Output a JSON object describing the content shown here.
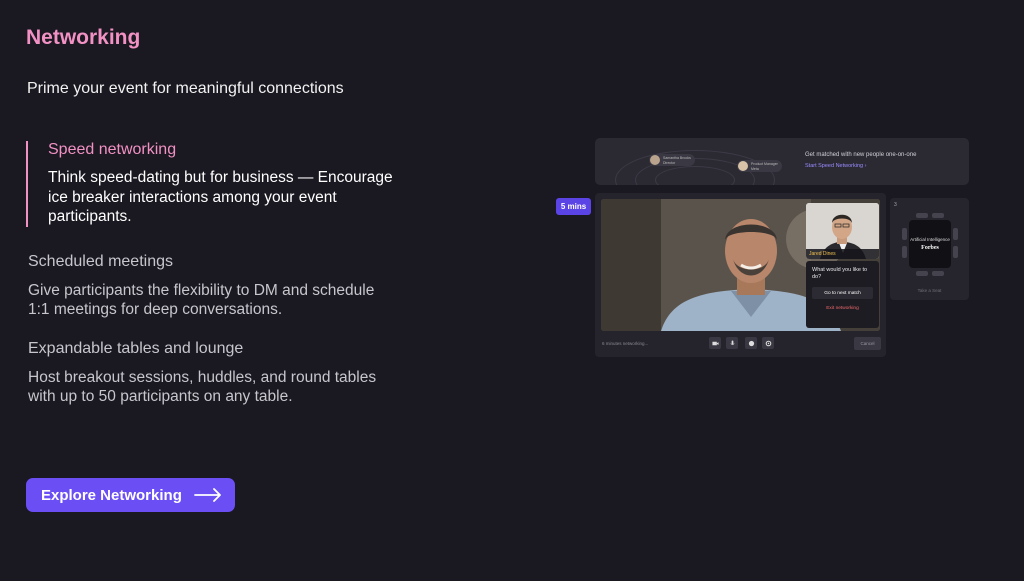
{
  "section": {
    "title": "Networking",
    "subtitle": "Prime your event for meaningful connections"
  },
  "features": [
    {
      "title": "Speed networking",
      "description": "Think speed-dating but for business — Encourage ice breaker interactions among your event participants."
    },
    {
      "title": "Scheduled meetings",
      "description": "Give participants the flexibility to DM and schedule 1:1 meetings for deep conversations."
    },
    {
      "title": "Expandable tables and lounge",
      "description": "Host breakout sessions, huddles, and round tables with up to 50 participants on any table."
    }
  ],
  "cta": {
    "label": "Explore Networking",
    "icon": "arrow-right-icon"
  },
  "mockup": {
    "top_card": {
      "chips": [
        {
          "name": "Samantha Brooks",
          "role": "Director"
        },
        {
          "name": "Product Manager",
          "role": "Meta"
        }
      ],
      "title": "Get matched with new people one-on-one",
      "link": "Start Speed Networking"
    },
    "timer_badge": "5 mins",
    "self_name": "Jared Dines",
    "prompt": {
      "question": "What would you like to do?",
      "primary": "Go to next match",
      "secondary": "Exit networking"
    },
    "controls": {
      "status": "6 minutes networking...",
      "cancel": "Cancel",
      "icons": [
        "camera-icon",
        "mic-icon",
        "chat-icon",
        "settings-icon"
      ]
    },
    "table": {
      "number": "3",
      "name": "Artificial Intelligence",
      "brand": "Forbes",
      "action": "Take a Seat"
    }
  },
  "colors": {
    "background": "#1a1820",
    "accent_pink": "#f291c4",
    "primary_button": "#6b4ff5"
  }
}
